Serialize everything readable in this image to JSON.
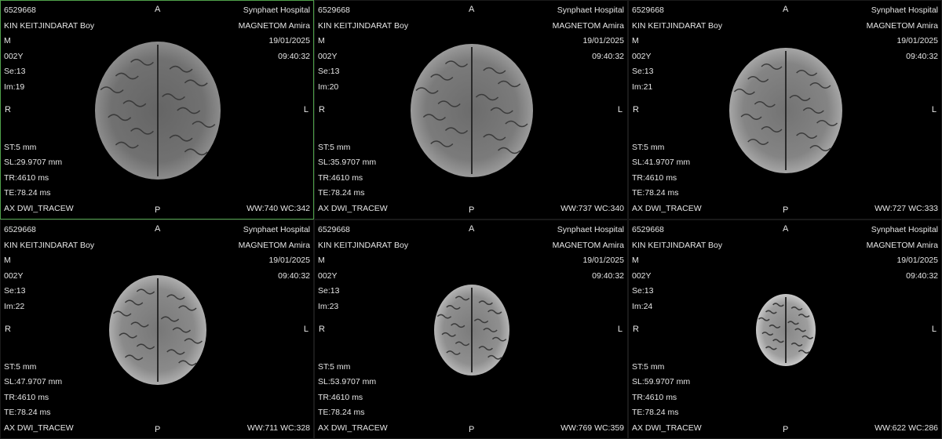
{
  "viewer": {
    "layout": "2x3",
    "accent_color": "#4fa14a",
    "viewports": [
      {
        "patient_id": "6529668",
        "patient_name": "KIN KEITJINDARAT  Boy",
        "sex": "M",
        "age": "002Y",
        "series": "Se:13",
        "image": "Im:19",
        "institution": "Synphaet Hospital",
        "scanner": "MAGNETOM Amira",
        "date": "19/01/2025",
        "time": "09:40:32",
        "slice_thickness": "ST:5 mm",
        "slice_location": "SL:29.9707 mm",
        "tr": "TR:4610 ms",
        "te": "TE:78.24 ms",
        "sequence": "AX DWI_TRACEW",
        "window": "WW:740 WC:342",
        "orient_top": "A",
        "orient_bottom": "P",
        "orient_left": "R",
        "orient_right": "L",
        "selected": true
      },
      {
        "patient_id": "6529668",
        "patient_name": "KIN KEITJINDARAT  Boy",
        "sex": "M",
        "age": "002Y",
        "series": "Se:13",
        "image": "Im:20",
        "institution": "Synphaet Hospital",
        "scanner": "MAGNETOM Amira",
        "date": "19/01/2025",
        "time": "09:40:32",
        "slice_thickness": "ST:5 mm",
        "slice_location": "SL:35.9707 mm",
        "tr": "TR:4610 ms",
        "te": "TE:78.24 ms",
        "sequence": "AX DWI_TRACEW",
        "window": "WW:737 WC:340",
        "orient_top": "A",
        "orient_bottom": "P",
        "orient_left": "R",
        "orient_right": "L",
        "selected": false
      },
      {
        "patient_id": "6529668",
        "patient_name": "KIN KEITJINDARAT  Boy",
        "sex": "M",
        "age": "002Y",
        "series": "Se:13",
        "image": "Im:21",
        "institution": "Synphaet Hospital",
        "scanner": "MAGNETOM Amira",
        "date": "19/01/2025",
        "time": "09:40:32",
        "slice_thickness": "ST:5 mm",
        "slice_location": "SL:41.9707 mm",
        "tr": "TR:4610 ms",
        "te": "TE:78.24 ms",
        "sequence": "AX DWI_TRACEW",
        "window": "WW:727 WC:333",
        "orient_top": "A",
        "orient_bottom": "P",
        "orient_left": "R",
        "orient_right": "L",
        "selected": false
      },
      {
        "patient_id": "6529668",
        "patient_name": "KIN KEITJINDARAT  Boy",
        "sex": "M",
        "age": "002Y",
        "series": "Se:13",
        "image": "Im:22",
        "institution": "Synphaet Hospital",
        "scanner": "MAGNETOM Amira",
        "date": "19/01/2025",
        "time": "09:40:32",
        "slice_thickness": "ST:5 mm",
        "slice_location": "SL:47.9707 mm",
        "tr": "TR:4610 ms",
        "te": "TE:78.24 ms",
        "sequence": "AX DWI_TRACEW",
        "window": "WW:711 WC:328",
        "orient_top": "A",
        "orient_bottom": "P",
        "orient_left": "R",
        "orient_right": "L",
        "selected": false
      },
      {
        "patient_id": "6529668",
        "patient_name": "KIN KEITJINDARAT  Boy",
        "sex": "M",
        "age": "002Y",
        "series": "Se:13",
        "image": "Im:23",
        "institution": "Synphaet Hospital",
        "scanner": "MAGNETOM Amira",
        "date": "19/01/2025",
        "time": "09:40:32",
        "slice_thickness": "ST:5 mm",
        "slice_location": "SL:53.9707 mm",
        "tr": "TR:4610 ms",
        "te": "TE:78.24 ms",
        "sequence": "AX DWI_TRACEW",
        "window": "WW:769 WC:359",
        "orient_top": "A",
        "orient_bottom": "P",
        "orient_left": "R",
        "orient_right": "L",
        "selected": false
      },
      {
        "patient_id": "6529668",
        "patient_name": "KIN KEITJINDARAT  Boy",
        "sex": "M",
        "age": "002Y",
        "series": "Se:13",
        "image": "Im:24",
        "institution": "Synphaet Hospital",
        "scanner": "MAGNETOM Amira",
        "date": "19/01/2025",
        "time": "09:40:32",
        "slice_thickness": "ST:5 mm",
        "slice_location": "SL:59.9707 mm",
        "tr": "TR:4610 ms",
        "te": "TE:78.24 ms",
        "sequence": "AX DWI_TRACEW",
        "window": "WW:622 WC:286",
        "orient_top": "A",
        "orient_bottom": "P",
        "orient_left": "R",
        "orient_right": "L",
        "selected": false
      }
    ]
  }
}
